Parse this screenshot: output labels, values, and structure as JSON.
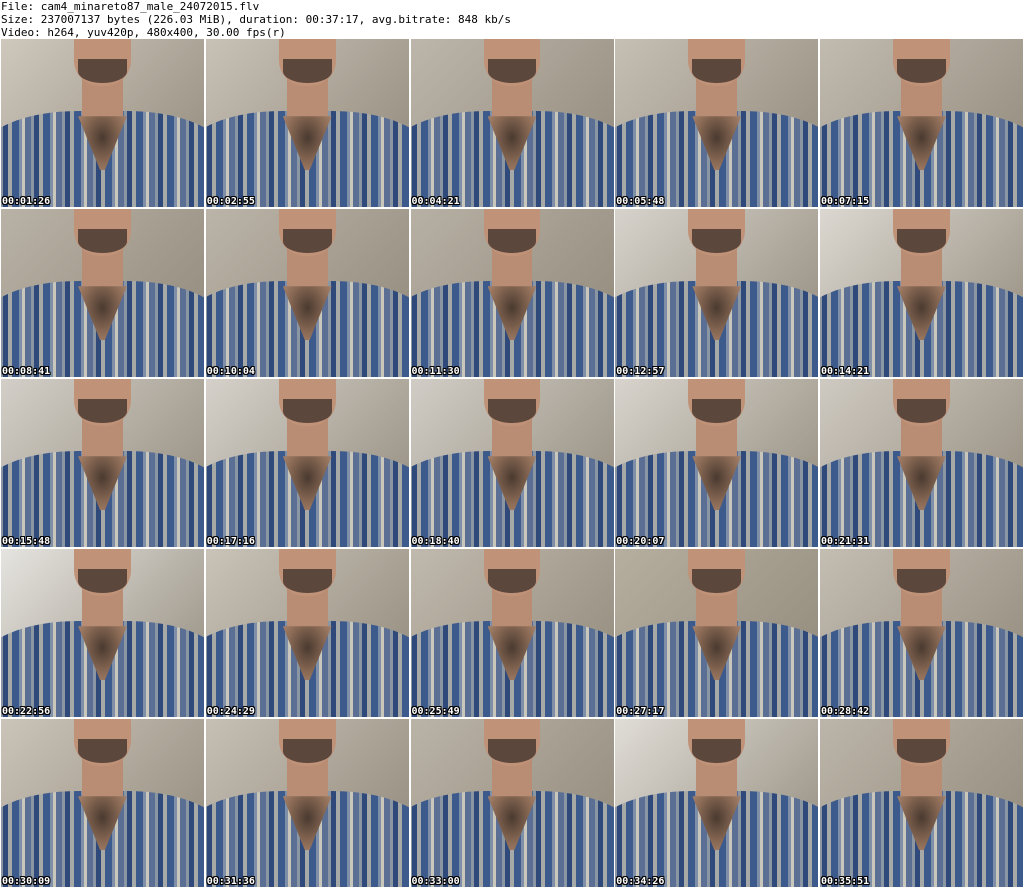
{
  "header": {
    "file_line": "File: cam4_minareto87_male_24072015.flv",
    "size_line": "Size: 237007137 bytes (226.03 MiB), duration: 00:37:17, avg.bitrate: 848 kb/s",
    "video_line": "Video: h264, yuv420p, 480x400, 30.00 fps(r)"
  },
  "thumbnails": [
    {
      "timestamp": "00:01:26",
      "wall": "#cfc8bd"
    },
    {
      "timestamp": "00:02:55",
      "wall": "#c8c1b6"
    },
    {
      "timestamp": "00:04:21",
      "wall": "#bdb6ab"
    },
    {
      "timestamp": "00:05:48",
      "wall": "#c6bfb4"
    },
    {
      "timestamp": "00:07:15",
      "wall": "#c2bbb0"
    },
    {
      "timestamp": "00:08:41",
      "wall": "#b9b2a6"
    },
    {
      "timestamp": "00:10:04",
      "wall": "#bbb4a8"
    },
    {
      "timestamp": "00:11:30",
      "wall": "#b7b0a4"
    },
    {
      "timestamp": "00:12:57",
      "wall": "#d7d3cc"
    },
    {
      "timestamp": "00:14:21",
      "wall": "#dcd8d1"
    },
    {
      "timestamp": "00:15:48",
      "wall": "#d3cfc8"
    },
    {
      "timestamp": "00:17:16",
      "wall": "#d5d1ca"
    },
    {
      "timestamp": "00:18:40",
      "wall": "#d1cdc6"
    },
    {
      "timestamp": "00:20:07",
      "wall": "#d8d4cd"
    },
    {
      "timestamp": "00:21:31",
      "wall": "#cfcac2"
    },
    {
      "timestamp": "00:22:56",
      "wall": "#e6e4e0"
    },
    {
      "timestamp": "00:24:29",
      "wall": "#c9c3b8"
    },
    {
      "timestamp": "00:25:49",
      "wall": "#c0b9ad"
    },
    {
      "timestamp": "00:27:17",
      "wall": "#b6ae9f"
    },
    {
      "timestamp": "00:28:42",
      "wall": "#c4bdb2"
    },
    {
      "timestamp": "00:30:09",
      "wall": "#cbc4b9"
    },
    {
      "timestamp": "00:31:36",
      "wall": "#c6bfb4"
    },
    {
      "timestamp": "00:33:00",
      "wall": "#bab3a7"
    },
    {
      "timestamp": "00:34:26",
      "wall": "#e0ddd7"
    },
    {
      "timestamp": "00:35:51",
      "wall": "#bcb5a9"
    }
  ]
}
